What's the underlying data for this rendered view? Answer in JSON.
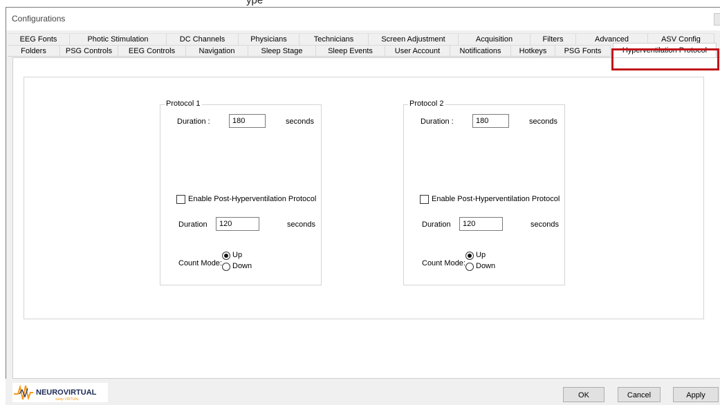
{
  "window_fragment": "ype",
  "dialog_title": "Configurations",
  "tabs_back": [
    {
      "label": "EEG Fonts"
    },
    {
      "label": "Photic Stimulation"
    },
    {
      "label": "DC Channels"
    },
    {
      "label": "Physicians"
    },
    {
      "label": "Technicians"
    },
    {
      "label": "Screen Adjustment"
    },
    {
      "label": "Acquisition"
    },
    {
      "label": "Filters"
    },
    {
      "label": "Advanced"
    },
    {
      "label": "ASV Config"
    }
  ],
  "tabs_front": [
    {
      "label": "Folders"
    },
    {
      "label": "PSG Controls"
    },
    {
      "label": "EEG Controls"
    },
    {
      "label": "Navigation"
    },
    {
      "label": "Sleep Stage"
    },
    {
      "label": "Sleep Events"
    },
    {
      "label": "User Account"
    },
    {
      "label": "Notifications"
    },
    {
      "label": "Hotkeys"
    },
    {
      "label": "PSG Fonts"
    },
    {
      "label": "Hyperventilation Protocol"
    }
  ],
  "active_tab": "Hyperventilation Protocol",
  "protocols": [
    {
      "title": "Protocol 1",
      "duration_label": "Duration :",
      "duration_value": "180",
      "duration_unit": "seconds",
      "post_checkbox_label": "Enable Post-Hyperventilation Protocol",
      "post_enabled": false,
      "post_duration_label": "Duration",
      "post_duration_value": "120",
      "post_duration_unit": "seconds",
      "count_mode_label": "Count Mode:",
      "count_options": [
        "Up",
        "Down"
      ],
      "count_selected": "Up"
    },
    {
      "title": "Protocol 2",
      "duration_label": "Duration :",
      "duration_value": "180",
      "duration_unit": "seconds",
      "post_checkbox_label": "Enable Post-Hyperventilation Protocol",
      "post_enabled": false,
      "post_duration_label": "Duration",
      "post_duration_value": "120",
      "post_duration_unit": "seconds",
      "count_mode_label": "Count Mode:",
      "count_options": [
        "Up",
        "Down"
      ],
      "count_selected": "Up"
    }
  ],
  "logo": {
    "brand": "NEUROVIRTUAL",
    "tagline": "sleep VIRTUAL"
  },
  "buttons": {
    "ok": "OK",
    "cancel": "Cancel",
    "apply": "Apply"
  },
  "colors": {
    "highlight": "#c0141a",
    "logo_orange": "#f39a1e",
    "logo_navy": "#1c2a56"
  }
}
